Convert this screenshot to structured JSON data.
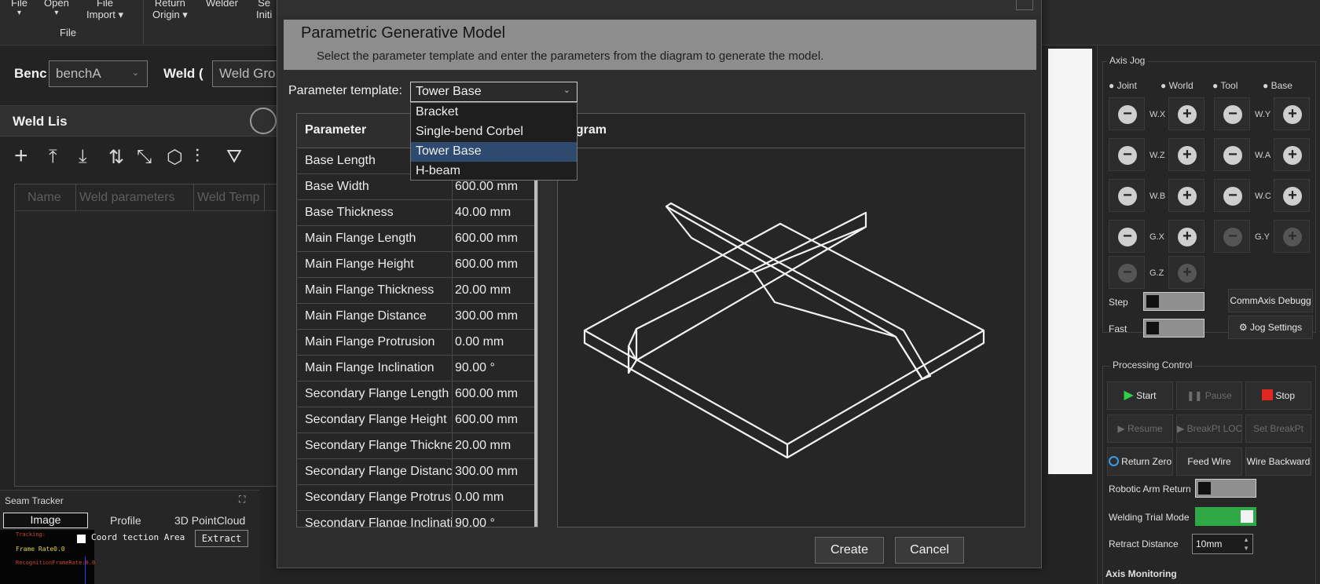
{
  "ribbon": {
    "items": [
      {
        "label": "File",
        "sub": "▾"
      },
      {
        "label": "Open",
        "sub": "▾"
      },
      {
        "label": "File",
        "sub": "Import ▾"
      },
      {
        "label": "Return",
        "sub": "Origin ▾"
      },
      {
        "label": "Welder",
        "sub": ""
      },
      {
        "label": "Se",
        "sub": "Initi"
      }
    ],
    "group_label": "File"
  },
  "left": {
    "bench_label": "Benc",
    "bench_value": "benchA",
    "weld_label": "Weld (",
    "weld_value": "Weld Gro",
    "weldlist_title": "Weld Lis",
    "columns": [
      "Name",
      "Weld parameters",
      "Weld Temp"
    ],
    "seam": {
      "title": "Seam Tracker",
      "tabs": [
        "Image",
        "Profile",
        "3D PointCloud"
      ],
      "coord_label": "Coord tection Area",
      "extract": "Extract",
      "overlay_lines": [
        "Tracking:",
        "Frame Rate0.0",
        "RecognitionFrameRate:0.0"
      ]
    }
  },
  "dialog": {
    "title": "Parametric Generative Model",
    "subtitle": "Select the parameter template and enter the parameters from the diagram to generate the model.",
    "template_label": "Parameter template:",
    "template_value": "Tower Base",
    "template_options": [
      "Bracket",
      "Single-bend Corbel",
      "Tower Base",
      "H-beam"
    ],
    "table_header": "Parameter",
    "diagram_header": "agram",
    "params": [
      {
        "name": "Base Length",
        "value": ""
      },
      {
        "name": "Base Width",
        "value": "600.00 mm"
      },
      {
        "name": "Base Thickness",
        "value": "40.00 mm"
      },
      {
        "name": "Main Flange Length",
        "value": "600.00 mm"
      },
      {
        "name": "Main Flange Height",
        "value": "600.00 mm"
      },
      {
        "name": "Main Flange Thickness",
        "value": "20.00 mm"
      },
      {
        "name": "Main Flange Distance",
        "value": "300.00 mm"
      },
      {
        "name": "Main Flange Protrusion",
        "value": "0.00 mm"
      },
      {
        "name": "Main Flange Inclination",
        "value": "90.00 °"
      },
      {
        "name": "Secondary Flange Length",
        "value": "600.00 mm"
      },
      {
        "name": "Secondary Flange Height",
        "value": "600.00 mm"
      },
      {
        "name": "Secondary Flange Thickness",
        "value": "20.00 mm"
      },
      {
        "name": "Secondary Flange Distance",
        "value": "300.00 mm"
      },
      {
        "name": "Secondary Flange Protrusion",
        "value": "0.00 mm"
      },
      {
        "name": "Secondary Flange Inclination",
        "value": "90.00 °"
      }
    ],
    "create": "Create",
    "cancel": "Cancel"
  },
  "right": {
    "axis_jog": "Axis Jog",
    "modes": [
      "Joint",
      "World",
      "Tool",
      "Base"
    ],
    "axes": [
      "W.X",
      "W.Y",
      "W.Z",
      "W.A",
      "W.B",
      "W.C",
      "G.X",
      "G.Y",
      "G.Z"
    ],
    "step": "Step",
    "fast": "Fast",
    "comm_axis": "CommAxis Debugg",
    "jog_settings": "Jog Settings",
    "processing": "Processing Control",
    "start": "Start",
    "pause": "Pause",
    "stop": "Stop",
    "resume": "Resume",
    "breakpt_loc": "BreakPt LOC",
    "set_breakpt": "Set BreakPt",
    "return_zero": "Return Zero",
    "feed_wire": "Feed Wire",
    "wire_backward": "Wire Backward",
    "robotic_arm_return": "Robotic Arm Return",
    "welding_trial": "Welding Trial Mode",
    "retract_distance": "Retract Distance",
    "retract_value": "10mm",
    "axis_monitoring": "Axis Monitoring",
    "colors": {
      "start": "#2fd04a",
      "stop": "#e0261f",
      "toggle_on": "#2fa845"
    }
  }
}
